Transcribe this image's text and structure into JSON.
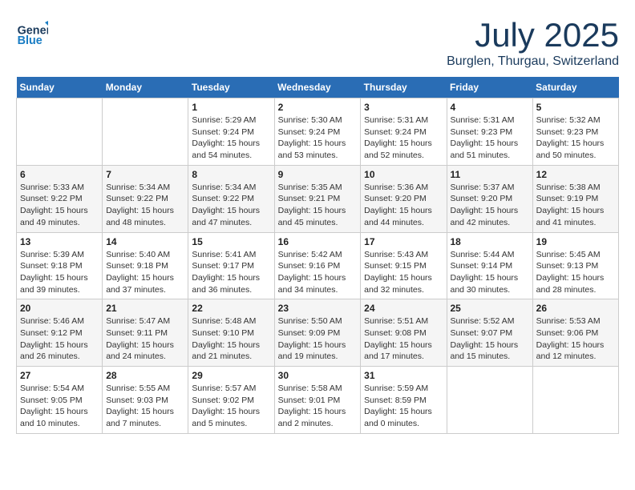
{
  "header": {
    "logo": {
      "general": "General",
      "blue": "Blue"
    },
    "month": "July 2025",
    "location": "Burglen, Thurgau, Switzerland"
  },
  "weekdays": [
    "Sunday",
    "Monday",
    "Tuesday",
    "Wednesday",
    "Thursday",
    "Friday",
    "Saturday"
  ],
  "weeks": [
    [
      {
        "day": "",
        "info": ""
      },
      {
        "day": "",
        "info": ""
      },
      {
        "day": "1",
        "sunrise": "5:29 AM",
        "sunset": "9:24 PM",
        "daylight": "15 hours and 54 minutes."
      },
      {
        "day": "2",
        "sunrise": "5:30 AM",
        "sunset": "9:24 PM",
        "daylight": "15 hours and 53 minutes."
      },
      {
        "day": "3",
        "sunrise": "5:31 AM",
        "sunset": "9:24 PM",
        "daylight": "15 hours and 52 minutes."
      },
      {
        "day": "4",
        "sunrise": "5:31 AM",
        "sunset": "9:23 PM",
        "daylight": "15 hours and 51 minutes."
      },
      {
        "day": "5",
        "sunrise": "5:32 AM",
        "sunset": "9:23 PM",
        "daylight": "15 hours and 50 minutes."
      }
    ],
    [
      {
        "day": "6",
        "sunrise": "5:33 AM",
        "sunset": "9:22 PM",
        "daylight": "15 hours and 49 minutes."
      },
      {
        "day": "7",
        "sunrise": "5:34 AM",
        "sunset": "9:22 PM",
        "daylight": "15 hours and 48 minutes."
      },
      {
        "day": "8",
        "sunrise": "5:34 AM",
        "sunset": "9:22 PM",
        "daylight": "15 hours and 47 minutes."
      },
      {
        "day": "9",
        "sunrise": "5:35 AM",
        "sunset": "9:21 PM",
        "daylight": "15 hours and 45 minutes."
      },
      {
        "day": "10",
        "sunrise": "5:36 AM",
        "sunset": "9:20 PM",
        "daylight": "15 hours and 44 minutes."
      },
      {
        "day": "11",
        "sunrise": "5:37 AM",
        "sunset": "9:20 PM",
        "daylight": "15 hours and 42 minutes."
      },
      {
        "day": "12",
        "sunrise": "5:38 AM",
        "sunset": "9:19 PM",
        "daylight": "15 hours and 41 minutes."
      }
    ],
    [
      {
        "day": "13",
        "sunrise": "5:39 AM",
        "sunset": "9:18 PM",
        "daylight": "15 hours and 39 minutes."
      },
      {
        "day": "14",
        "sunrise": "5:40 AM",
        "sunset": "9:18 PM",
        "daylight": "15 hours and 37 minutes."
      },
      {
        "day": "15",
        "sunrise": "5:41 AM",
        "sunset": "9:17 PM",
        "daylight": "15 hours and 36 minutes."
      },
      {
        "day": "16",
        "sunrise": "5:42 AM",
        "sunset": "9:16 PM",
        "daylight": "15 hours and 34 minutes."
      },
      {
        "day": "17",
        "sunrise": "5:43 AM",
        "sunset": "9:15 PM",
        "daylight": "15 hours and 32 minutes."
      },
      {
        "day": "18",
        "sunrise": "5:44 AM",
        "sunset": "9:14 PM",
        "daylight": "15 hours and 30 minutes."
      },
      {
        "day": "19",
        "sunrise": "5:45 AM",
        "sunset": "9:13 PM",
        "daylight": "15 hours and 28 minutes."
      }
    ],
    [
      {
        "day": "20",
        "sunrise": "5:46 AM",
        "sunset": "9:12 PM",
        "daylight": "15 hours and 26 minutes."
      },
      {
        "day": "21",
        "sunrise": "5:47 AM",
        "sunset": "9:11 PM",
        "daylight": "15 hours and 24 minutes."
      },
      {
        "day": "22",
        "sunrise": "5:48 AM",
        "sunset": "9:10 PM",
        "daylight": "15 hours and 21 minutes."
      },
      {
        "day": "23",
        "sunrise": "5:50 AM",
        "sunset": "9:09 PM",
        "daylight": "15 hours and 19 minutes."
      },
      {
        "day": "24",
        "sunrise": "5:51 AM",
        "sunset": "9:08 PM",
        "daylight": "15 hours and 17 minutes."
      },
      {
        "day": "25",
        "sunrise": "5:52 AM",
        "sunset": "9:07 PM",
        "daylight": "15 hours and 15 minutes."
      },
      {
        "day": "26",
        "sunrise": "5:53 AM",
        "sunset": "9:06 PM",
        "daylight": "15 hours and 12 minutes."
      }
    ],
    [
      {
        "day": "27",
        "sunrise": "5:54 AM",
        "sunset": "9:05 PM",
        "daylight": "15 hours and 10 minutes."
      },
      {
        "day": "28",
        "sunrise": "5:55 AM",
        "sunset": "9:03 PM",
        "daylight": "15 hours and 7 minutes."
      },
      {
        "day": "29",
        "sunrise": "5:57 AM",
        "sunset": "9:02 PM",
        "daylight": "15 hours and 5 minutes."
      },
      {
        "day": "30",
        "sunrise": "5:58 AM",
        "sunset": "9:01 PM",
        "daylight": "15 hours and 2 minutes."
      },
      {
        "day": "31",
        "sunrise": "5:59 AM",
        "sunset": "8:59 PM",
        "daylight": "15 hours and 0 minutes."
      },
      {
        "day": "",
        "info": ""
      },
      {
        "day": "",
        "info": ""
      }
    ]
  ],
  "labels": {
    "sunrise": "Sunrise:",
    "sunset": "Sunset:",
    "daylight": "Daylight:"
  }
}
